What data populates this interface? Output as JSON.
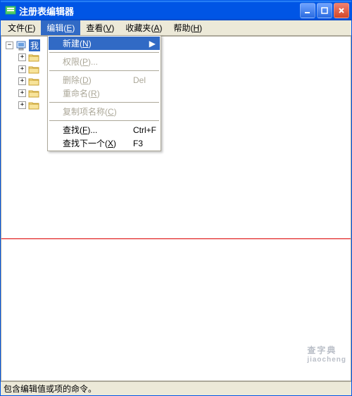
{
  "titlebar": {
    "title": "注册表编辑器"
  },
  "menubar": {
    "file": {
      "label": "文件",
      "mnemonic": "F"
    },
    "edit": {
      "label": "编辑",
      "mnemonic": "E"
    },
    "view": {
      "label": "查看",
      "mnemonic": "V"
    },
    "favorites": {
      "label": "收藏夹",
      "mnemonic": "A"
    },
    "help": {
      "label": "帮助",
      "mnemonic": "H"
    }
  },
  "dropdown": {
    "new": {
      "label": "新建",
      "mnemonic": "N"
    },
    "permissions": {
      "label": "权限",
      "mnemonic": "P",
      "suffix": "..."
    },
    "delete": {
      "label": "删除",
      "mnemonic": "D",
      "shortcut": "Del"
    },
    "rename": {
      "label": "重命名",
      "mnemonic": "R"
    },
    "copykey": {
      "label": "复制项名称",
      "mnemonic": "C"
    },
    "find": {
      "label": "查找",
      "mnemonic": "F",
      "suffix": "...",
      "shortcut": "Ctrl+F"
    },
    "findnext": {
      "label": "查找下一个",
      "mnemonic": "X",
      "shortcut": "F3"
    }
  },
  "tree": {
    "root": "我",
    "children": [
      "",
      "",
      "",
      "",
      ""
    ]
  },
  "statusbar": {
    "text": "包含编辑值或项的命令。"
  },
  "watermark": {
    "line1": "查字典",
    "line2": "jiaocheng"
  }
}
